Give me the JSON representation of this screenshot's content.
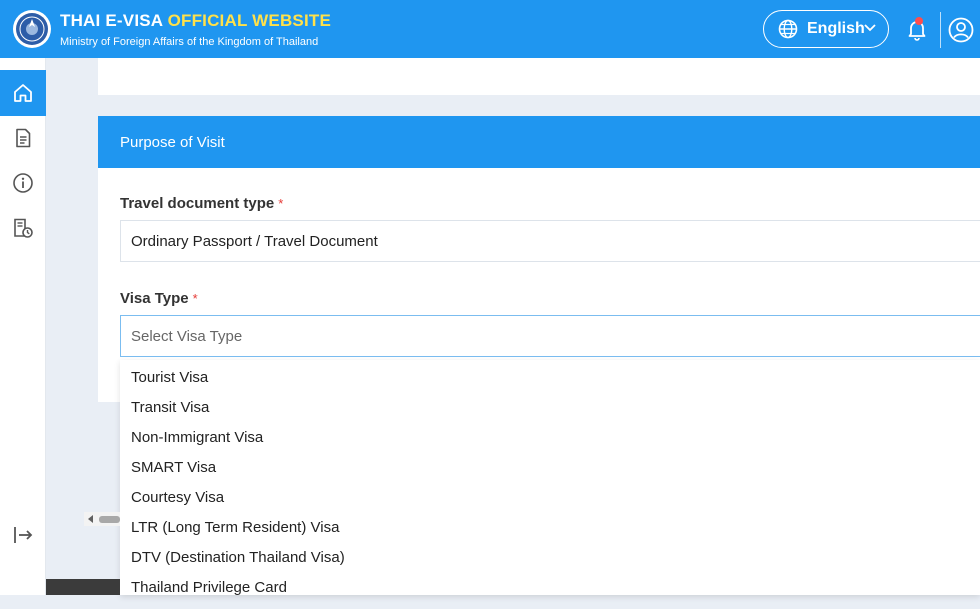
{
  "header": {
    "title_main": "THAI E-VISA ",
    "title_highlight": "OFFICIAL WEBSITE",
    "subtitle": "Ministry of Foreign Affairs of the Kingdom of Thailand",
    "language": "English",
    "brand_color": "#1f96f0",
    "highlight_color": "#ffe14a"
  },
  "sidebar": {
    "items": [
      {
        "icon": "home-icon",
        "active": true
      },
      {
        "icon": "document-icon",
        "active": false
      },
      {
        "icon": "info-icon",
        "active": false
      },
      {
        "icon": "receipt-icon",
        "active": false
      }
    ],
    "logout_icon": "logout-icon"
  },
  "form": {
    "section_title": "Purpose of Visit",
    "travel_doc": {
      "label": "Travel document type",
      "required_mark": "*",
      "value": "Ordinary Passport / Travel Document"
    },
    "visa_type": {
      "label": "Visa Type",
      "required_mark": "*",
      "placeholder": "Select Visa Type",
      "options": [
        "Tourist Visa",
        "Transit Visa",
        "Non-Immigrant Visa",
        "SMART Visa",
        "Courtesy Visa",
        "LTR (Long Term Resident) Visa",
        "DTV (Destination Thailand Visa)",
        "Thailand Privilege Card"
      ]
    }
  }
}
